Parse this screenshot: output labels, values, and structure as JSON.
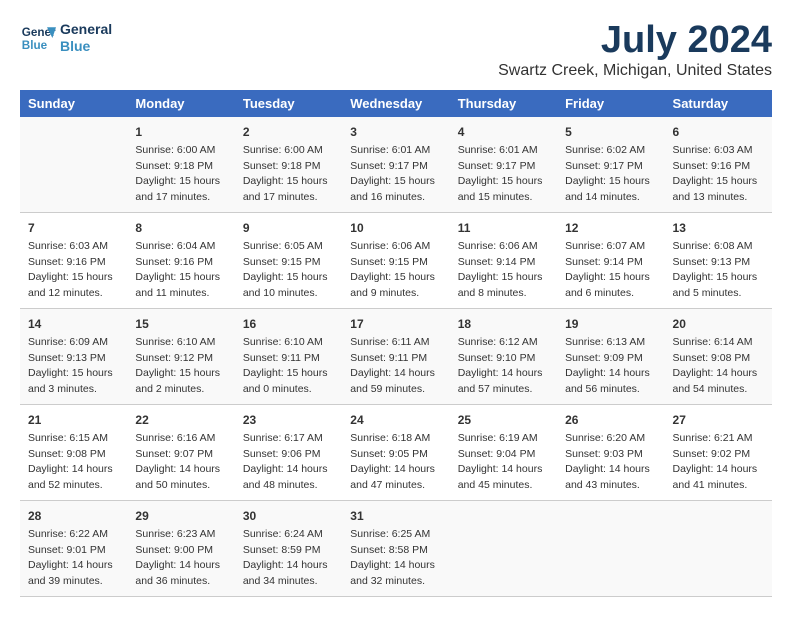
{
  "header": {
    "logo_line1": "General",
    "logo_line2": "Blue",
    "title": "July 2024",
    "subtitle": "Swartz Creek, Michigan, United States"
  },
  "days_of_week": [
    "Sunday",
    "Monday",
    "Tuesday",
    "Wednesday",
    "Thursday",
    "Friday",
    "Saturday"
  ],
  "weeks": [
    [
      {
        "day": "",
        "content": ""
      },
      {
        "day": "1",
        "content": "Sunrise: 6:00 AM\nSunset: 9:18 PM\nDaylight: 15 hours\nand 17 minutes."
      },
      {
        "day": "2",
        "content": "Sunrise: 6:00 AM\nSunset: 9:18 PM\nDaylight: 15 hours\nand 17 minutes."
      },
      {
        "day": "3",
        "content": "Sunrise: 6:01 AM\nSunset: 9:17 PM\nDaylight: 15 hours\nand 16 minutes."
      },
      {
        "day": "4",
        "content": "Sunrise: 6:01 AM\nSunset: 9:17 PM\nDaylight: 15 hours\nand 15 minutes."
      },
      {
        "day": "5",
        "content": "Sunrise: 6:02 AM\nSunset: 9:17 PM\nDaylight: 15 hours\nand 14 minutes."
      },
      {
        "day": "6",
        "content": "Sunrise: 6:03 AM\nSunset: 9:16 PM\nDaylight: 15 hours\nand 13 minutes."
      }
    ],
    [
      {
        "day": "7",
        "content": "Sunrise: 6:03 AM\nSunset: 9:16 PM\nDaylight: 15 hours\nand 12 minutes."
      },
      {
        "day": "8",
        "content": "Sunrise: 6:04 AM\nSunset: 9:16 PM\nDaylight: 15 hours\nand 11 minutes."
      },
      {
        "day": "9",
        "content": "Sunrise: 6:05 AM\nSunset: 9:15 PM\nDaylight: 15 hours\nand 10 minutes."
      },
      {
        "day": "10",
        "content": "Sunrise: 6:06 AM\nSunset: 9:15 PM\nDaylight: 15 hours\nand 9 minutes."
      },
      {
        "day": "11",
        "content": "Sunrise: 6:06 AM\nSunset: 9:14 PM\nDaylight: 15 hours\nand 8 minutes."
      },
      {
        "day": "12",
        "content": "Sunrise: 6:07 AM\nSunset: 9:14 PM\nDaylight: 15 hours\nand 6 minutes."
      },
      {
        "day": "13",
        "content": "Sunrise: 6:08 AM\nSunset: 9:13 PM\nDaylight: 15 hours\nand 5 minutes."
      }
    ],
    [
      {
        "day": "14",
        "content": "Sunrise: 6:09 AM\nSunset: 9:13 PM\nDaylight: 15 hours\nand 3 minutes."
      },
      {
        "day": "15",
        "content": "Sunrise: 6:10 AM\nSunset: 9:12 PM\nDaylight: 15 hours\nand 2 minutes."
      },
      {
        "day": "16",
        "content": "Sunrise: 6:10 AM\nSunset: 9:11 PM\nDaylight: 15 hours\nand 0 minutes."
      },
      {
        "day": "17",
        "content": "Sunrise: 6:11 AM\nSunset: 9:11 PM\nDaylight: 14 hours\nand 59 minutes."
      },
      {
        "day": "18",
        "content": "Sunrise: 6:12 AM\nSunset: 9:10 PM\nDaylight: 14 hours\nand 57 minutes."
      },
      {
        "day": "19",
        "content": "Sunrise: 6:13 AM\nSunset: 9:09 PM\nDaylight: 14 hours\nand 56 minutes."
      },
      {
        "day": "20",
        "content": "Sunrise: 6:14 AM\nSunset: 9:08 PM\nDaylight: 14 hours\nand 54 minutes."
      }
    ],
    [
      {
        "day": "21",
        "content": "Sunrise: 6:15 AM\nSunset: 9:08 PM\nDaylight: 14 hours\nand 52 minutes."
      },
      {
        "day": "22",
        "content": "Sunrise: 6:16 AM\nSunset: 9:07 PM\nDaylight: 14 hours\nand 50 minutes."
      },
      {
        "day": "23",
        "content": "Sunrise: 6:17 AM\nSunset: 9:06 PM\nDaylight: 14 hours\nand 48 minutes."
      },
      {
        "day": "24",
        "content": "Sunrise: 6:18 AM\nSunset: 9:05 PM\nDaylight: 14 hours\nand 47 minutes."
      },
      {
        "day": "25",
        "content": "Sunrise: 6:19 AM\nSunset: 9:04 PM\nDaylight: 14 hours\nand 45 minutes."
      },
      {
        "day": "26",
        "content": "Sunrise: 6:20 AM\nSunset: 9:03 PM\nDaylight: 14 hours\nand 43 minutes."
      },
      {
        "day": "27",
        "content": "Sunrise: 6:21 AM\nSunset: 9:02 PM\nDaylight: 14 hours\nand 41 minutes."
      }
    ],
    [
      {
        "day": "28",
        "content": "Sunrise: 6:22 AM\nSunset: 9:01 PM\nDaylight: 14 hours\nand 39 minutes."
      },
      {
        "day": "29",
        "content": "Sunrise: 6:23 AM\nSunset: 9:00 PM\nDaylight: 14 hours\nand 36 minutes."
      },
      {
        "day": "30",
        "content": "Sunrise: 6:24 AM\nSunset: 8:59 PM\nDaylight: 14 hours\nand 34 minutes."
      },
      {
        "day": "31",
        "content": "Sunrise: 6:25 AM\nSunset: 8:58 PM\nDaylight: 14 hours\nand 32 minutes."
      },
      {
        "day": "",
        "content": ""
      },
      {
        "day": "",
        "content": ""
      },
      {
        "day": "",
        "content": ""
      }
    ]
  ]
}
